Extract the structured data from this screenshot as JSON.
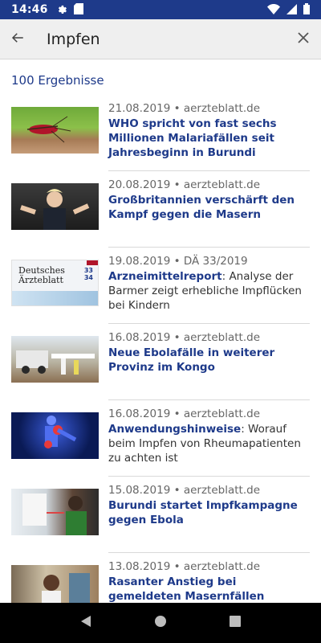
{
  "status_bar": {
    "time": "14:46"
  },
  "search": {
    "query": "Impfen"
  },
  "results_count": "100 Ergebnisse",
  "cover": {
    "line1": "Deutsches",
    "line2": "Ärzteblatt",
    "issue_top": "33",
    "issue_bottom": "34"
  },
  "items": [
    {
      "meta": "21.08.2019 • aerzteblatt.de",
      "title": "WHO spricht von fast sechs Millionen Malariafällen seit Jahresbeginn in Burundi",
      "rest": ""
    },
    {
      "meta": "20.08.2019 • aerzteblatt.de",
      "title": "Großbritannien verschärft den Kampf gegen die Masern",
      "rest": ""
    },
    {
      "meta": "19.08.2019 • DÄ 33/2019",
      "title": "Arzneimittelreport",
      "rest": ": Analyse der Barmer zeigt erhebliche Impflücken bei Kindern"
    },
    {
      "meta": "16.08.2019 • aerzteblatt.de",
      "title": "Neue Ebolafälle in weiterer Provinz im Kongo",
      "rest": ""
    },
    {
      "meta": "16.08.2019 • aerzteblatt.de",
      "title": "Anwendungshinweise",
      "rest": ": Worauf beim Impfen von Rheumapatienten zu achten ist"
    },
    {
      "meta": "15.08.2019 • aerzteblatt.de",
      "title": "Burundi startet Impfkampagne gegen Ebola",
      "rest": ""
    },
    {
      "meta": "13.08.2019 • aerzteblatt.de",
      "title": "Rasanter Anstieg bei gemeldeten Masernfällen weltweit",
      "rest": ""
    }
  ],
  "colors": {
    "status_bar": "#1e3a8a",
    "accent": "#1e3a8a",
    "search_bar": "#efefef",
    "nav_bar": "#000000"
  }
}
